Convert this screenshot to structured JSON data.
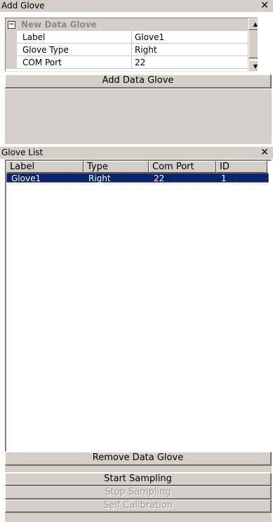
{
  "add_glove_panel": {
    "title": "Add Glove",
    "close_glyph": "✕",
    "category": {
      "label": "New Data Glove",
      "expand_glyph": "−"
    },
    "properties": [
      {
        "name": "Label",
        "value": "Glove1"
      },
      {
        "name": "Glove Type",
        "value": "Right"
      },
      {
        "name": "COM Port",
        "value": "22"
      }
    ],
    "scroll_up_glyph": "▲",
    "scroll_down_glyph": "▼",
    "add_button_label": "Add Data Glove"
  },
  "glove_list_panel": {
    "title": "Glove List",
    "close_glyph": "✕",
    "columns": [
      "Label",
      "Type",
      "Com Port",
      "ID"
    ],
    "rows": [
      {
        "label": "Glove1",
        "type": "Right",
        "com_port": "22",
        "id": "1"
      }
    ],
    "remove_button_label": "Remove Data Glove"
  },
  "sampling": {
    "start_label": "Start Sampling",
    "stop_label": "Stop Sampling",
    "calibration_label": "Self Calibration"
  },
  "colors": {
    "panel_gray": "#d4d0c8",
    "selection": "#0a246a",
    "category_text": "#8a8a8a"
  }
}
